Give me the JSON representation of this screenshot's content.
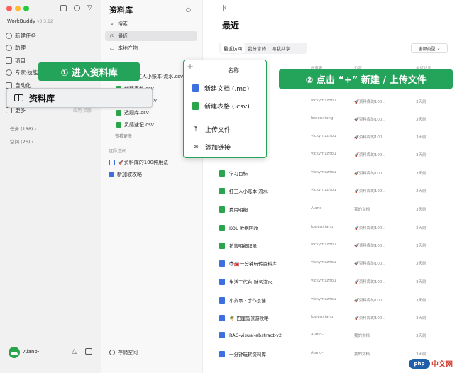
{
  "window": {
    "traffic_lights": [
      "#ff5f57",
      "#febc2e",
      "#28c840"
    ]
  },
  "left_sidebar": {
    "app_name": "WorkBuddy",
    "app_version": "v3.3.12",
    "nav": [
      {
        "label": "新建任务",
        "icon": "plus-circle-icon"
      },
      {
        "label": "助理",
        "icon": "assistant-icon"
      },
      {
        "label": "项目",
        "icon": "folder-icon"
      },
      {
        "label": "专家·技能",
        "icon": "expert-icon"
      },
      {
        "label": "自动化",
        "icon": "automation-icon"
      },
      {
        "label": "更多",
        "icon": "more-icon"
      }
    ],
    "more_note": "应用·灵感",
    "sections": [
      {
        "label": "任务 (188)"
      },
      {
        "label": "空间 (26)"
      }
    ],
    "user_name": "Alano-"
  },
  "middle": {
    "title": "资料库",
    "nav": [
      {
        "label": "搜索",
        "icon": "search-icon"
      },
      {
        "label": "最近",
        "icon": "clock-icon"
      },
      {
        "label": "本地产物",
        "icon": "folder-icon"
      }
    ],
    "files": [
      {
        "label": "工人小账本·流水.csv",
        "type": "sheet"
      },
      {
        "label": "新建表格.csv",
        "type": "sheet"
      },
      {
        "label": "统计.csv",
        "type": "sheet"
      },
      {
        "label": "选题库.csv",
        "type": "sheet"
      },
      {
        "label": "灵感速记.csv",
        "type": "sheet"
      }
    ],
    "see_more": "查看更多",
    "team_space": "团队空间",
    "team_items": [
      {
        "label": "🚀资料库的100种用法",
        "type": "check"
      },
      {
        "label": "新加坡攻略",
        "type": "doc"
      }
    ],
    "storage": "存储空间"
  },
  "main": {
    "title": "最近",
    "tabs": [
      {
        "label": "最近访问",
        "active": true
      },
      {
        "label": "我分享的",
        "active": false
      },
      {
        "label": "与我共享",
        "active": false
      }
    ],
    "type_filter": "全部类型",
    "columns": {
      "name": "名称",
      "owner": "所有者",
      "location": "位置",
      "time": "最近访问"
    },
    "rows": [
      {
        "name": "",
        "owner": "vickymzzhou",
        "location": "🚀资料库的100...",
        "time": "3天前",
        "type": "sheet"
      },
      {
        "name": "",
        "owner": "lowenxiang",
        "location": "🚀资料库的100...",
        "time": "3天前",
        "type": "sheet"
      },
      {
        "name": "",
        "owner": "vickymzzhou",
        "location": "🚀资料库的100...",
        "time": "3天前",
        "type": "sheet"
      },
      {
        "name": "",
        "owner": "vickymzzhou",
        "location": "🚀资料库的100...",
        "time": "3天前",
        "type": "sheet"
      },
      {
        "name": "学习目标",
        "owner": "vickymzzhou",
        "location": "🚀资料库的100...",
        "time": "3天前",
        "type": "sheet"
      },
      {
        "name": "打工人小账本·流水",
        "owner": "vickymzzhou",
        "location": "🚀资料库的100...",
        "time": "3天前",
        "type": "sheet"
      },
      {
        "name": "费用明细",
        "owner": "Alano-",
        "location": "我的文档",
        "time": "3天前",
        "type": "sheet"
      },
      {
        "name": "KOL 数据回收",
        "owner": "lowenxiang",
        "location": "🚀资料库的100...",
        "time": "3天前",
        "type": "sheet"
      },
      {
        "name": "销售明细记录",
        "owner": "vickymzzhou",
        "location": "🚀资料库的100...",
        "time": "3天前",
        "type": "sheet"
      },
      {
        "name": "😎🚘一分钟玩转资料库",
        "owner": "vickymzzhou",
        "location": "🚀资料库的100...",
        "time": "3天前",
        "type": "doc"
      },
      {
        "name": "生活工作台·财务流水",
        "owner": "vickymzzhou",
        "location": "🚀资料库的100...",
        "time": "3天前",
        "type": "doc"
      },
      {
        "name": "小茶事 · 手作茶铺",
        "owner": "vickymzzhou",
        "location": "🚀资料库的100...",
        "time": "3天前",
        "type": "doc"
      },
      {
        "name": "🌴 巴厘岛旅游攻略",
        "owner": "lowenxiang",
        "location": "🚀资料库的100...",
        "time": "3天前",
        "type": "doc"
      },
      {
        "name": "RAG-visual-abstract-v2",
        "owner": "Alano-",
        "location": "我的文档",
        "time": "3天前",
        "type": "doc"
      },
      {
        "name": "一分钟玩转资料库",
        "owner": "Alano-",
        "location": "我的文档",
        "time": "3天前",
        "type": "doc"
      }
    ]
  },
  "overlays": {
    "step1": "① 进入资料库",
    "library_button": "资料库",
    "step2": "② 点击 “+” 新建 / 上传文件",
    "popup": {
      "header": "名称",
      "items": [
        {
          "label": "新建文档 (.md)",
          "icon": "doc-icon"
        },
        {
          "label": "新建表格 (.csv)",
          "icon": "sheet-icon"
        },
        {
          "label": "上传文件",
          "icon": "upload-icon"
        },
        {
          "label": "添加链接",
          "icon": "link-icon"
        }
      ]
    }
  },
  "watermark": {
    "logo": "php",
    "text": "中文网"
  },
  "colors": {
    "accent_green": "#24a35a",
    "sheet_green": "#2aa54c",
    "doc_blue": "#3d6fe0"
  }
}
